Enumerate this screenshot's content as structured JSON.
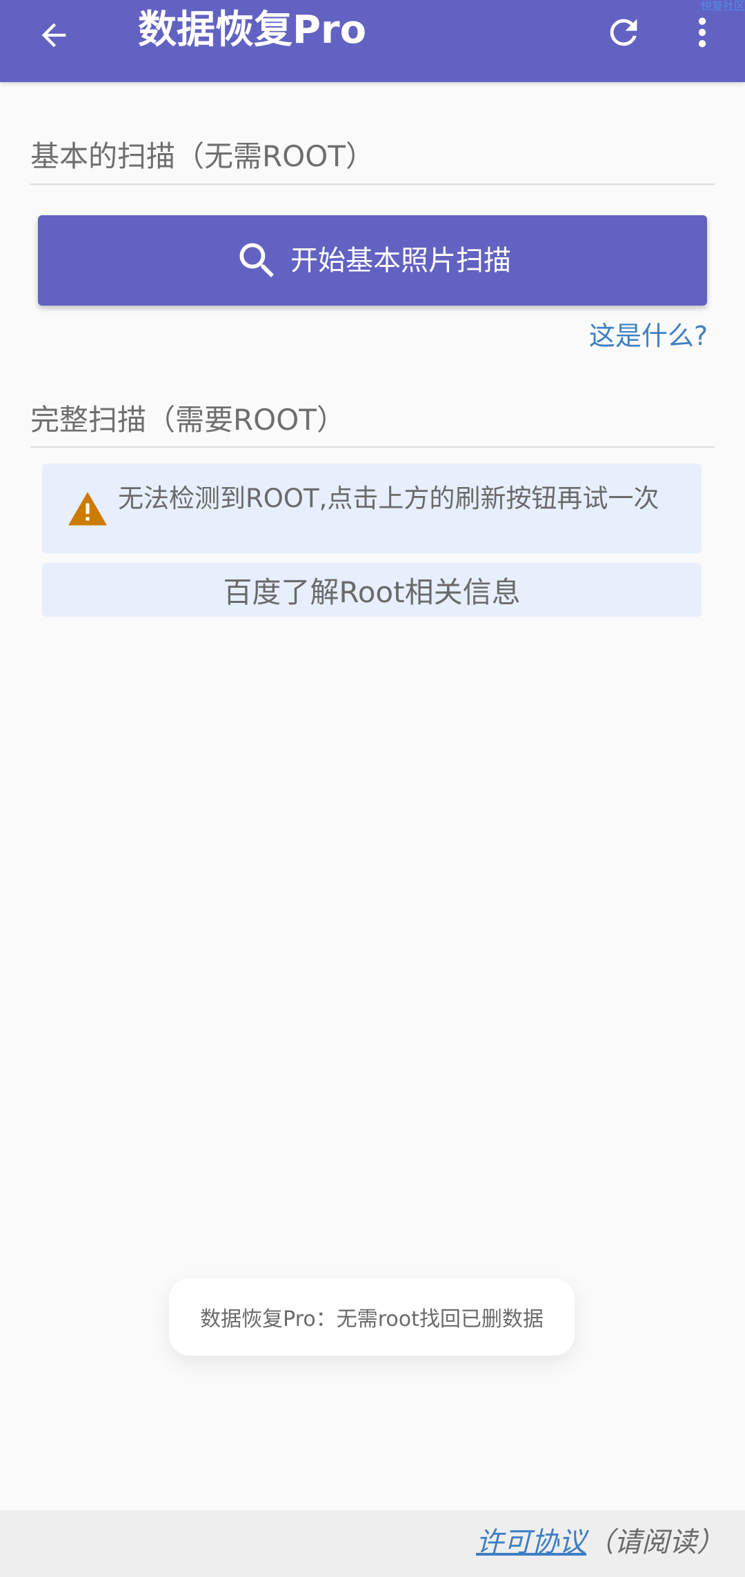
{
  "appbar": {
    "title": "数据恢复Pro",
    "back_icon": "arrow-left-icon",
    "refresh_icon": "refresh-icon",
    "more_icon": "more-vert-icon",
    "bg_color": "#6262c2",
    "watermark": "锐复社区"
  },
  "basic_scan": {
    "title": "基本的扫描（无需ROOT）",
    "button_label": "开始基本照片扫描",
    "button_icon": "search-icon",
    "help_link": "这是什么?"
  },
  "full_scan": {
    "title": "完整扫描（需要ROOT）",
    "warning_icon": "warning-icon",
    "warning_color": "#cc7a00",
    "warning_text": "无法检测到ROOT,点击上方的刷新按钮再试一次",
    "info_button_label": "百度了解Root相关信息"
  },
  "toast": {
    "text": "数据恢复Pro：无需root找回已删数据"
  },
  "footer": {
    "license_link": "许可协议",
    "license_note": "（请阅读）",
    "link_color": "#3d7fc4"
  }
}
